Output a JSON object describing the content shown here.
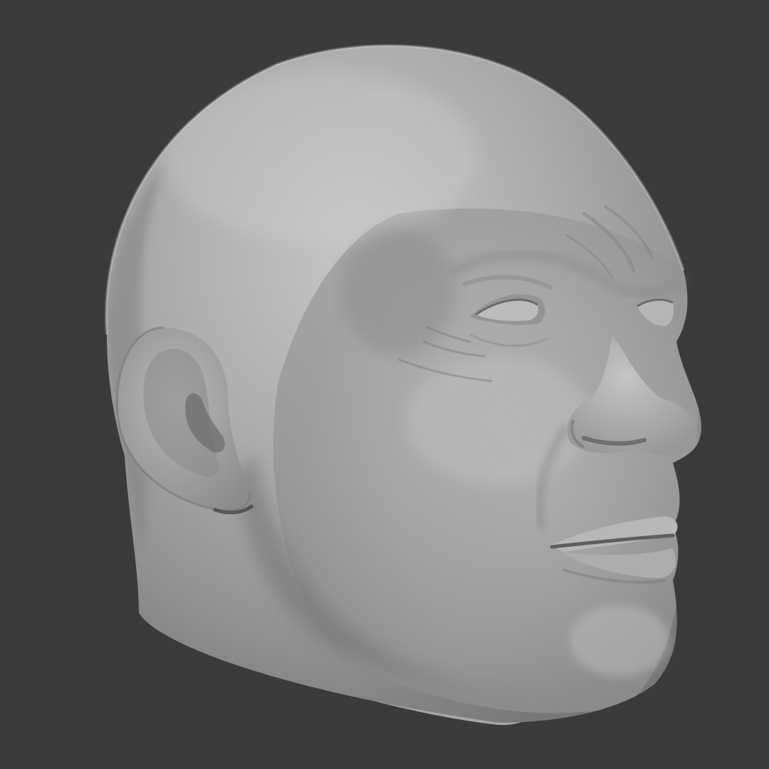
{
  "viewport": {
    "background_color": "#3b3b3b",
    "model_base_color": "#a3a3a3",
    "model_highlight_color": "#c9c9c9",
    "model_shadow_color": "#6a6a6a",
    "subject": "sculpted-head-clay-render"
  }
}
